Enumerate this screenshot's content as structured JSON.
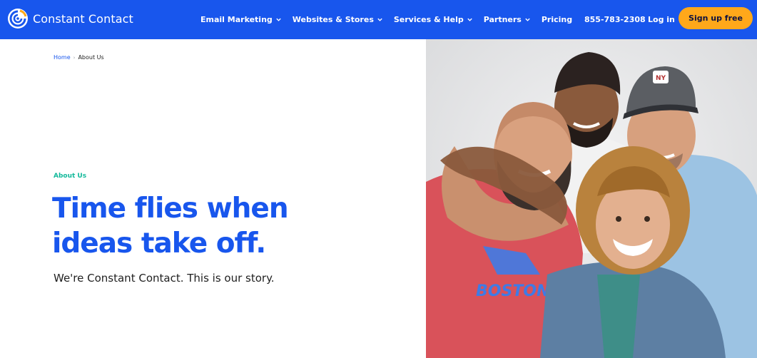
{
  "header": {
    "brand": "Constant Contact",
    "nav": [
      {
        "label": "Email Marketing",
        "has_menu": true
      },
      {
        "label": "Websites & Stores",
        "has_menu": true
      },
      {
        "label": "Services & Help",
        "has_menu": true
      },
      {
        "label": "Partners",
        "has_menu": true
      },
      {
        "label": "Pricing",
        "has_menu": false
      }
    ],
    "phone": "855-783-2308",
    "login_label": "Log in",
    "signup_label": "Sign up free"
  },
  "breadcrumb": {
    "home": "Home",
    "separator": "›",
    "current": "About Us"
  },
  "hero": {
    "eyebrow": "About Us",
    "headline_line1": "Time flies when",
    "headline_line2": "ideas take off.",
    "subhead": "We're Constant Contact. This is our story.",
    "shirt_text": "BOSTON",
    "cap_badge": "NY"
  },
  "colors": {
    "brand_blue": "#1856ED",
    "signup_orange": "#FFA81A",
    "eyebrow_green": "#13B99B",
    "text_dark": "#1f1f1f"
  },
  "icons": [
    "constant-contact-logo-icon",
    "chevron-down-icon"
  ]
}
